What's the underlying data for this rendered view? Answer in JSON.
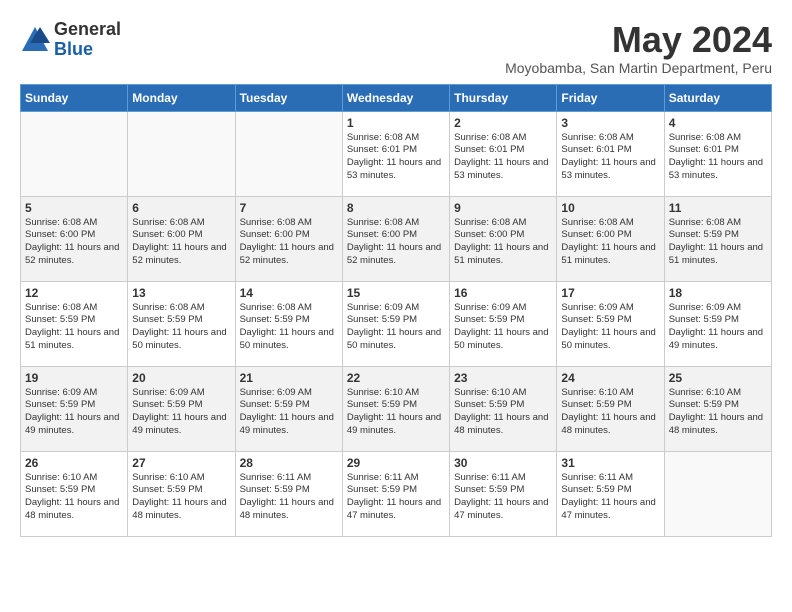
{
  "logo": {
    "general": "General",
    "blue": "Blue"
  },
  "title": "May 2024",
  "subtitle": "Moyobamba, San Martin Department, Peru",
  "days_header": [
    "Sunday",
    "Monday",
    "Tuesday",
    "Wednesday",
    "Thursday",
    "Friday",
    "Saturday"
  ],
  "weeks": [
    [
      {
        "day": "",
        "info": ""
      },
      {
        "day": "",
        "info": ""
      },
      {
        "day": "",
        "info": ""
      },
      {
        "day": "1",
        "info": "Sunrise: 6:08 AM\nSunset: 6:01 PM\nDaylight: 11 hours and 53 minutes."
      },
      {
        "day": "2",
        "info": "Sunrise: 6:08 AM\nSunset: 6:01 PM\nDaylight: 11 hours and 53 minutes."
      },
      {
        "day": "3",
        "info": "Sunrise: 6:08 AM\nSunset: 6:01 PM\nDaylight: 11 hours and 53 minutes."
      },
      {
        "day": "4",
        "info": "Sunrise: 6:08 AM\nSunset: 6:01 PM\nDaylight: 11 hours and 53 minutes."
      }
    ],
    [
      {
        "day": "5",
        "info": "Sunrise: 6:08 AM\nSunset: 6:00 PM\nDaylight: 11 hours and 52 minutes."
      },
      {
        "day": "6",
        "info": "Sunrise: 6:08 AM\nSunset: 6:00 PM\nDaylight: 11 hours and 52 minutes."
      },
      {
        "day": "7",
        "info": "Sunrise: 6:08 AM\nSunset: 6:00 PM\nDaylight: 11 hours and 52 minutes."
      },
      {
        "day": "8",
        "info": "Sunrise: 6:08 AM\nSunset: 6:00 PM\nDaylight: 11 hours and 52 minutes."
      },
      {
        "day": "9",
        "info": "Sunrise: 6:08 AM\nSunset: 6:00 PM\nDaylight: 11 hours and 51 minutes."
      },
      {
        "day": "10",
        "info": "Sunrise: 6:08 AM\nSunset: 6:00 PM\nDaylight: 11 hours and 51 minutes."
      },
      {
        "day": "11",
        "info": "Sunrise: 6:08 AM\nSunset: 5:59 PM\nDaylight: 11 hours and 51 minutes."
      }
    ],
    [
      {
        "day": "12",
        "info": "Sunrise: 6:08 AM\nSunset: 5:59 PM\nDaylight: 11 hours and 51 minutes."
      },
      {
        "day": "13",
        "info": "Sunrise: 6:08 AM\nSunset: 5:59 PM\nDaylight: 11 hours and 50 minutes."
      },
      {
        "day": "14",
        "info": "Sunrise: 6:08 AM\nSunset: 5:59 PM\nDaylight: 11 hours and 50 minutes."
      },
      {
        "day": "15",
        "info": "Sunrise: 6:09 AM\nSunset: 5:59 PM\nDaylight: 11 hours and 50 minutes."
      },
      {
        "day": "16",
        "info": "Sunrise: 6:09 AM\nSunset: 5:59 PM\nDaylight: 11 hours and 50 minutes."
      },
      {
        "day": "17",
        "info": "Sunrise: 6:09 AM\nSunset: 5:59 PM\nDaylight: 11 hours and 50 minutes."
      },
      {
        "day": "18",
        "info": "Sunrise: 6:09 AM\nSunset: 5:59 PM\nDaylight: 11 hours and 49 minutes."
      }
    ],
    [
      {
        "day": "19",
        "info": "Sunrise: 6:09 AM\nSunset: 5:59 PM\nDaylight: 11 hours and 49 minutes."
      },
      {
        "day": "20",
        "info": "Sunrise: 6:09 AM\nSunset: 5:59 PM\nDaylight: 11 hours and 49 minutes."
      },
      {
        "day": "21",
        "info": "Sunrise: 6:09 AM\nSunset: 5:59 PM\nDaylight: 11 hours and 49 minutes."
      },
      {
        "day": "22",
        "info": "Sunrise: 6:10 AM\nSunset: 5:59 PM\nDaylight: 11 hours and 49 minutes."
      },
      {
        "day": "23",
        "info": "Sunrise: 6:10 AM\nSunset: 5:59 PM\nDaylight: 11 hours and 48 minutes."
      },
      {
        "day": "24",
        "info": "Sunrise: 6:10 AM\nSunset: 5:59 PM\nDaylight: 11 hours and 48 minutes."
      },
      {
        "day": "25",
        "info": "Sunrise: 6:10 AM\nSunset: 5:59 PM\nDaylight: 11 hours and 48 minutes."
      }
    ],
    [
      {
        "day": "26",
        "info": "Sunrise: 6:10 AM\nSunset: 5:59 PM\nDaylight: 11 hours and 48 minutes."
      },
      {
        "day": "27",
        "info": "Sunrise: 6:10 AM\nSunset: 5:59 PM\nDaylight: 11 hours and 48 minutes."
      },
      {
        "day": "28",
        "info": "Sunrise: 6:11 AM\nSunset: 5:59 PM\nDaylight: 11 hours and 48 minutes."
      },
      {
        "day": "29",
        "info": "Sunrise: 6:11 AM\nSunset: 5:59 PM\nDaylight: 11 hours and 47 minutes."
      },
      {
        "day": "30",
        "info": "Sunrise: 6:11 AM\nSunset: 5:59 PM\nDaylight: 11 hours and 47 minutes."
      },
      {
        "day": "31",
        "info": "Sunrise: 6:11 AM\nSunset: 5:59 PM\nDaylight: 11 hours and 47 minutes."
      },
      {
        "day": "",
        "info": ""
      }
    ]
  ]
}
